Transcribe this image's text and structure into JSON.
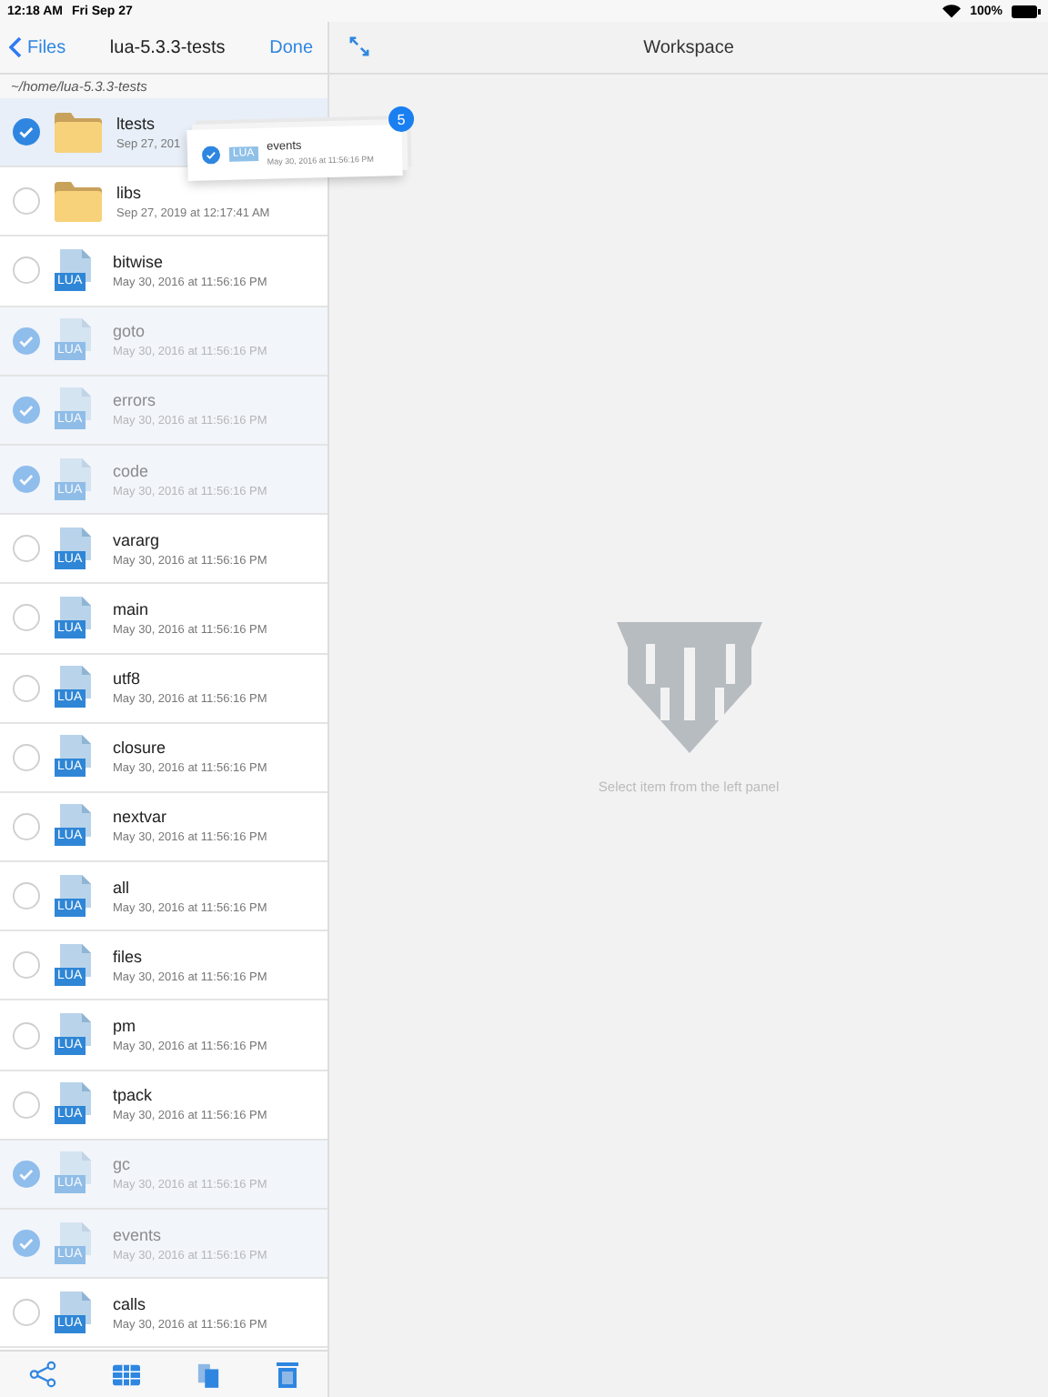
{
  "status_bar": {
    "time": "12:18 AM",
    "date": "Fri Sep 27",
    "battery_text": "100%"
  },
  "sidebar": {
    "back_label": "Files",
    "title": "lua-5.3.3-tests",
    "done_label": "Done",
    "path": "~/home/lua-5.3.3-tests",
    "items": [
      {
        "kind": "folder",
        "name": "ltests",
        "date": "Sep 27, 201",
        "selected": true,
        "dragging": false
      },
      {
        "kind": "folder",
        "name": "libs",
        "date": "Sep 27, 2019 at 12:17:41 AM",
        "selected": false,
        "dragging": false
      },
      {
        "kind": "lua",
        "icon_label": "LUA",
        "name": "bitwise",
        "date": "May 30, 2016 at 11:56:16 PM",
        "selected": false,
        "dragging": false
      },
      {
        "kind": "lua",
        "icon_label": "LUA",
        "name": "goto",
        "date": "May 30, 2016 at 11:56:16 PM",
        "selected": true,
        "dragging": true
      },
      {
        "kind": "lua",
        "icon_label": "LUA",
        "name": "errors",
        "date": "May 30, 2016 at 11:56:16 PM",
        "selected": true,
        "dragging": true
      },
      {
        "kind": "lua",
        "icon_label": "LUA",
        "name": "code",
        "date": "May 30, 2016 at 11:56:16 PM",
        "selected": true,
        "dragging": true
      },
      {
        "kind": "lua",
        "icon_label": "LUA",
        "name": "vararg",
        "date": "May 30, 2016 at 11:56:16 PM",
        "selected": false,
        "dragging": false
      },
      {
        "kind": "lua",
        "icon_label": "LUA",
        "name": "main",
        "date": "May 30, 2016 at 11:56:16 PM",
        "selected": false,
        "dragging": false
      },
      {
        "kind": "lua",
        "icon_label": "LUA",
        "name": "utf8",
        "date": "May 30, 2016 at 11:56:16 PM",
        "selected": false,
        "dragging": false
      },
      {
        "kind": "lua",
        "icon_label": "LUA",
        "name": "closure",
        "date": "May 30, 2016 at 11:56:16 PM",
        "selected": false,
        "dragging": false
      },
      {
        "kind": "lua",
        "icon_label": "LUA",
        "name": "nextvar",
        "date": "May 30, 2016 at 11:56:16 PM",
        "selected": false,
        "dragging": false
      },
      {
        "kind": "lua",
        "icon_label": "LUA",
        "name": "all",
        "date": "May 30, 2016 at 11:56:16 PM",
        "selected": false,
        "dragging": false
      },
      {
        "kind": "lua",
        "icon_label": "LUA",
        "name": "files",
        "date": "May 30, 2016 at 11:56:16 PM",
        "selected": false,
        "dragging": false
      },
      {
        "kind": "lua",
        "icon_label": "LUA",
        "name": "pm",
        "date": "May 30, 2016 at 11:56:16 PM",
        "selected": false,
        "dragging": false
      },
      {
        "kind": "lua",
        "icon_label": "LUA",
        "name": "tpack",
        "date": "May 30, 2016 at 11:56:16 PM",
        "selected": false,
        "dragging": false
      },
      {
        "kind": "lua",
        "icon_label": "LUA",
        "name": "gc",
        "date": "May 30, 2016 at 11:56:16 PM",
        "selected": true,
        "dragging": true
      },
      {
        "kind": "lua",
        "icon_label": "LUA",
        "name": "events",
        "date": "May 30, 2016 at 11:56:16 PM",
        "selected": true,
        "dragging": true
      },
      {
        "kind": "lua",
        "icon_label": "LUA",
        "name": "calls",
        "date": "May 30, 2016 at 11:56:16 PM",
        "selected": false,
        "dragging": false
      }
    ]
  },
  "drag_preview": {
    "count": "5",
    "icon_label": "LUA",
    "name": "events",
    "date": "May 30, 2016 at 11:56:16 PM"
  },
  "workspace": {
    "title": "Workspace",
    "empty_message": "Select item from the left panel"
  }
}
